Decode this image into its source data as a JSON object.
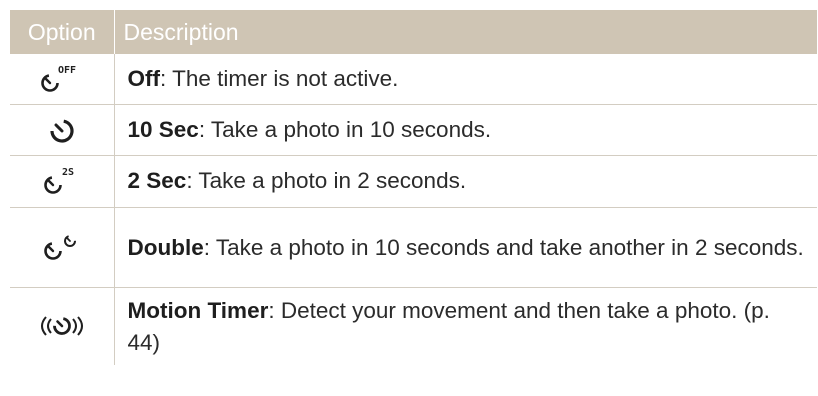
{
  "table": {
    "headers": {
      "option": "Option",
      "description": "Description"
    },
    "rows": [
      {
        "icon": "timer-off-icon",
        "icon_tag": "OFF",
        "term": "Off",
        "text": ": The timer is not active."
      },
      {
        "icon": "timer-10-sec-icon",
        "term": "10 Sec",
        "text": ": Take a photo in 10 seconds."
      },
      {
        "icon": "timer-2-sec-icon",
        "icon_tag": "2S",
        "term": "2 Sec",
        "text": ": Take a photo in 2 seconds."
      },
      {
        "icon": "timer-double-icon",
        "term": "Double",
        "text": ": Take a photo in 10 seconds and take another in 2 seconds."
      },
      {
        "icon": "motion-timer-icon",
        "term": "Motion Timer",
        "text": ": Detect your movement and then take a photo. (p. 44)"
      }
    ]
  },
  "colors": {
    "header_bg": "#cfc5b4",
    "header_text": "#ffffff",
    "rule": "#d3cdc2",
    "body_text": "#2b2b2b"
  }
}
